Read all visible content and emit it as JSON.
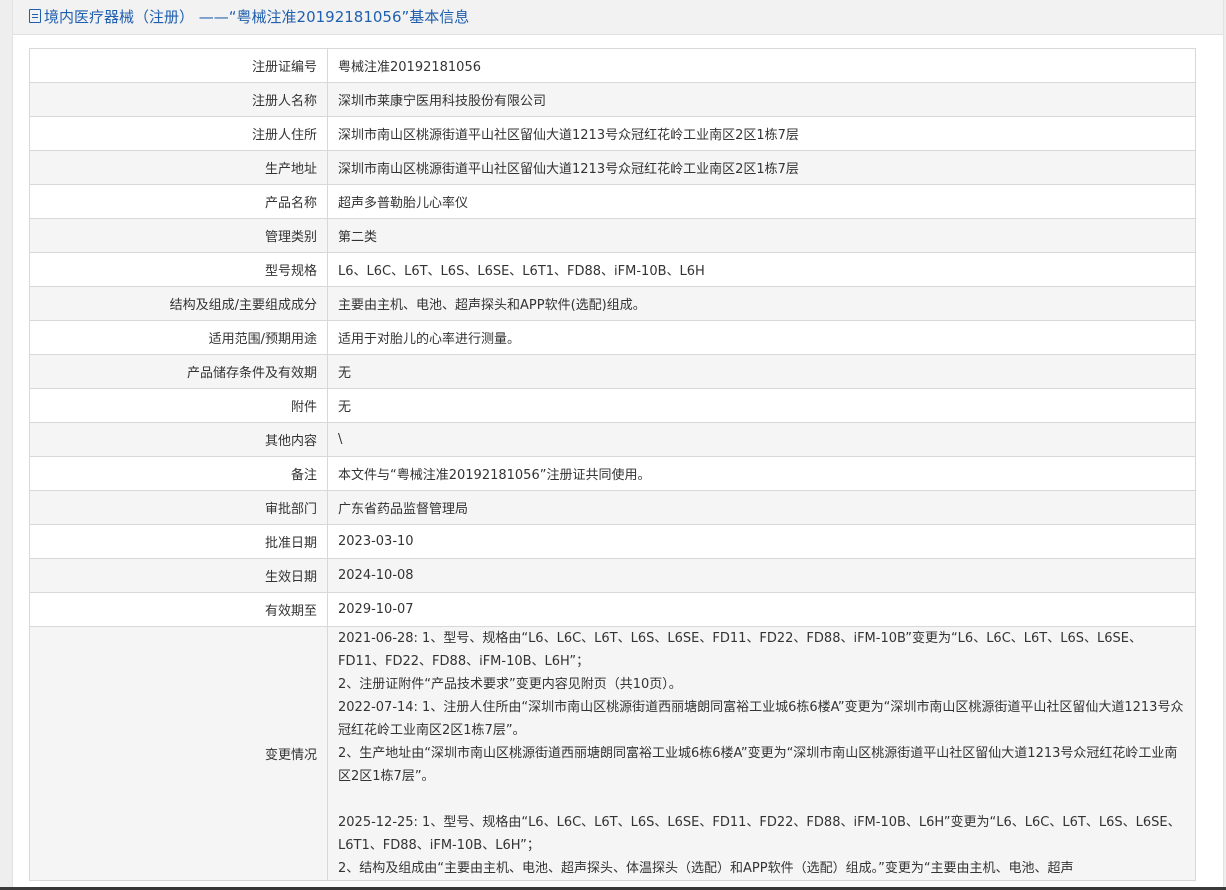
{
  "header": {
    "title": "境内医疗器械（注册） ——“粤械注准20192181056”基本信息",
    "icon": "document-icon"
  },
  "rows": [
    {
      "label": "注册证编号",
      "value": "粤械注准20192181056"
    },
    {
      "label": "注册人名称",
      "value": "深圳市莱康宁医用科技股份有限公司"
    },
    {
      "label": "注册人住所",
      "value": "深圳市南山区桃源街道平山社区留仙大道1213号众冠红花岭工业南区2区1栋7层"
    },
    {
      "label": "生产地址",
      "value": "深圳市南山区桃源街道平山社区留仙大道1213号众冠红花岭工业南区2区1栋7层"
    },
    {
      "label": "产品名称",
      "value": "超声多普勒胎儿心率仪"
    },
    {
      "label": "管理类别",
      "value": "第二类"
    },
    {
      "label": "型号规格",
      "value": "L6、L6C、L6T、L6S、L6SE、L6T1、FD88、iFM-10B、L6H"
    },
    {
      "label": "结构及组成/主要组成成分",
      "value": "主要由主机、电池、超声探头和APP软件(选配)组成。"
    },
    {
      "label": "适用范围/预期用途",
      "value": "适用于对胎儿的心率进行测量。"
    },
    {
      "label": "产品储存条件及有效期",
      "value": "无"
    },
    {
      "label": "附件",
      "value": "无"
    },
    {
      "label": "其他内容",
      "value": "\\"
    },
    {
      "label": "备注",
      "value": "本文件与“粤械注准20192181056”注册证共同使用。"
    },
    {
      "label": "审批部门",
      "value": "广东省药品监督管理局"
    },
    {
      "label": "批准日期",
      "value": "2023-03-10"
    },
    {
      "label": "生效日期",
      "value": "2024-10-08"
    },
    {
      "label": "有效期至",
      "value": "2029-10-07"
    }
  ],
  "changes": {
    "label": "变更情况",
    "lines": [
      "2021-06-28: 1、型号、规格由“L6、L6C、L6T、L6S、L6SE、FD11、FD22、FD88、iFM-10B”变更为“L6、L6C、L6T、L6S、L6SE、FD11、FD22、FD88、iFM-10B、L6H”；",
      "2、注册证附件“产品技术要求”变更内容见附页（共10页）。",
      "2022-07-14: 1、注册人住所由“深圳市南山区桃源街道西丽塘朗同富裕工业城6栋6楼A”变更为“深圳市南山区桃源街道平山社区留仙大道1213号众冠红花岭工业南区2区1栋7层”。",
      "2、生产地址由“深圳市南山区桃源街道西丽塘朗同富裕工业城6栋6楼A”变更为“深圳市南山区桃源街道平山社区留仙大道1213号众冠红花岭工业南区2区1栋7层”。",
      "",
      "2025-12-25: 1、型号、规格由“L6、L6C、L6T、L6S、L6SE、FD11、FD22、FD88、iFM-10B、L6H”变更为“L6、L6C、L6T、L6S、L6SE、L6T1、FD88、iFM-10B、L6H”；",
      "2、结构及组成由“主要由主机、电池、超声探头、体温探头（选配）和APP软件（选配）组成。”变更为“主要由主机、电池、超声"
    ]
  }
}
